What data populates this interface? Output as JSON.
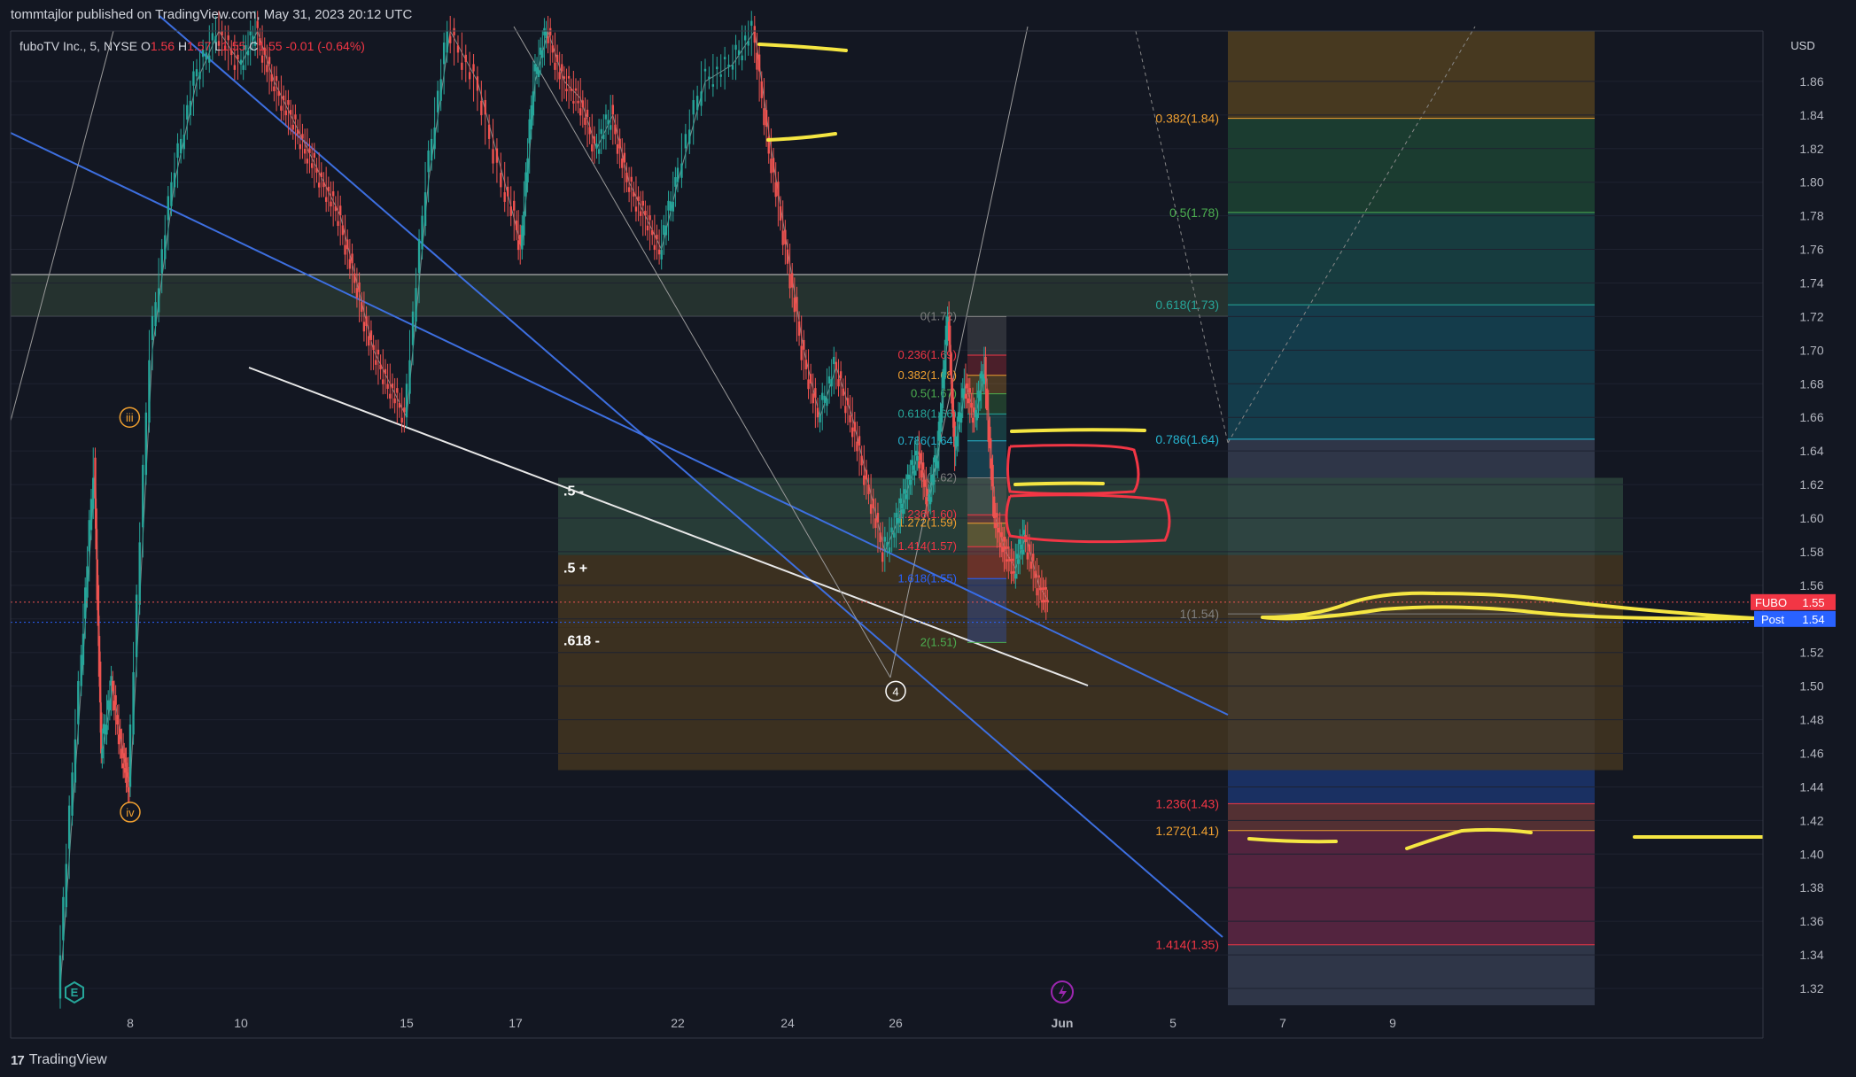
{
  "header": {
    "published": "tommtajlor published on TradingView.com, May 31, 2023 20:12 UTC"
  },
  "legend": {
    "symbol": "fuboTV Inc., 5, NYSE",
    "o_label": "O",
    "o_value": "1.56",
    "h_label": "H",
    "h_value": "1.57",
    "l_label": "L",
    "l_value": "1.55",
    "c_label": "C",
    "c_value": "1.55",
    "change": "-0.01 (-0.64%)"
  },
  "footer": {
    "brand": "TradingView"
  },
  "colors": {
    "background": "#131722",
    "up": "#26a69a",
    "down": "#ef5350",
    "yellow_marker": "#f5e642",
    "red_marker": "#f23645",
    "trend_blue": "#3d6fe0"
  },
  "chart_data": {
    "type": "candlestick",
    "title": "",
    "symbol": "FUBO",
    "currency": "USD",
    "ylim": [
      1.31,
      1.89
    ],
    "y_ticks": [
      "1.86",
      "1.84",
      "1.82",
      "1.80",
      "1.78",
      "1.76",
      "1.74",
      "1.72",
      "1.70",
      "1.68",
      "1.66",
      "1.64",
      "1.62",
      "1.60",
      "1.58",
      "1.56",
      "1.54",
      "1.52",
      "1.50",
      "1.48",
      "1.46",
      "1.44",
      "1.42",
      "1.40",
      "1.38",
      "1.36",
      "1.34",
      "1.32"
    ],
    "x_ticks": [
      {
        "label": "8",
        "day": 8
      },
      {
        "label": "10",
        "day": 10
      },
      {
        "label": "15",
        "day": 15
      },
      {
        "label": "17",
        "day": 17
      },
      {
        "label": "22",
        "day": 22
      },
      {
        "label": "24",
        "day": 24
      },
      {
        "label": "26",
        "day": 26
      },
      {
        "label": "Jun",
        "day": 31
      },
      {
        "label": "5",
        "day": 35
      },
      {
        "label": "7",
        "day": 37
      },
      {
        "label": "9",
        "day": 39
      }
    ],
    "price_path": [
      [
        6.0,
        1.32
      ],
      [
        6.6,
        1.5
      ],
      [
        7.0,
        1.63
      ],
      [
        7.2,
        1.46
      ],
      [
        7.5,
        1.5
      ],
      [
        7.8,
        1.46
      ],
      [
        8.0,
        1.44
      ],
      [
        8.4,
        1.7
      ],
      [
        8.8,
        1.8
      ],
      [
        9.2,
        1.86
      ],
      [
        9.6,
        1.89
      ],
      [
        10.0,
        1.87
      ],
      [
        10.5,
        1.89
      ],
      [
        11.0,
        1.86
      ],
      [
        11.5,
        1.84
      ],
      [
        12.0,
        1.82
      ],
      [
        12.5,
        1.8
      ],
      [
        13.0,
        1.78
      ],
      [
        13.5,
        1.74
      ],
      [
        14.0,
        1.7
      ],
      [
        14.5,
        1.68
      ],
      [
        15.0,
        1.66
      ],
      [
        15.4,
        1.8
      ],
      [
        15.8,
        1.89
      ],
      [
        16.3,
        1.86
      ],
      [
        16.8,
        1.8
      ],
      [
        17.2,
        1.76
      ],
      [
        17.6,
        1.86
      ],
      [
        18.0,
        1.89
      ],
      [
        18.5,
        1.86
      ],
      [
        19.0,
        1.85
      ],
      [
        19.5,
        1.82
      ],
      [
        20.0,
        1.84
      ],
      [
        20.5,
        1.8
      ],
      [
        21.0,
        1.78
      ],
      [
        21.5,
        1.76
      ],
      [
        22.0,
        1.8
      ],
      [
        22.5,
        1.86
      ],
      [
        23.0,
        1.87
      ],
      [
        23.4,
        1.89
      ],
      [
        23.7,
        1.82
      ],
      [
        24.0,
        1.76
      ],
      [
        24.3,
        1.7
      ],
      [
        24.6,
        1.66
      ],
      [
        24.9,
        1.69
      ],
      [
        25.2,
        1.66
      ],
      [
        25.5,
        1.62
      ],
      [
        25.8,
        1.58
      ],
      [
        26.1,
        1.6
      ],
      [
        26.4,
        1.62
      ],
      [
        26.7,
        1.64
      ],
      [
        27.0,
        1.61
      ],
      [
        27.3,
        1.64
      ],
      [
        27.6,
        1.72
      ],
      [
        27.8,
        1.64
      ],
      [
        28.1,
        1.68
      ],
      [
        28.4,
        1.66
      ],
      [
        28.7,
        1.69
      ],
      [
        29.0,
        1.6
      ],
      [
        29.3,
        1.58
      ],
      [
        29.6,
        1.57
      ],
      [
        29.9,
        1.59
      ],
      [
        30.3,
        1.56
      ],
      [
        30.6,
        1.55
      ]
    ],
    "last_price": {
      "symbol": "FUBO",
      "value": "1.55"
    },
    "post_price": {
      "label": "Post",
      "value": "1.54"
    },
    "horizontal_band": {
      "from": 1.72,
      "to": 1.745
    },
    "zones": [
      {
        "name": ".5 -",
        "from": 1.578,
        "to": 1.624,
        "color": "#2f4a3f"
      },
      {
        "name": ".5 +",
        "from": 1.535,
        "to": 1.578,
        "color": "#4a3a20"
      },
      {
        "name": ".618 -",
        "from": 1.45,
        "to": 1.535,
        "color": "#4a3a20"
      }
    ],
    "fib_right": [
      {
        "label": "0.382(1.84)",
        "value": 1.838,
        "color": "#f0a030"
      },
      {
        "label": "0.5(1.78)",
        "value": 1.782,
        "color": "#4caf50"
      },
      {
        "label": "0.618(1.73)",
        "value": 1.727,
        "color": "#26a69a"
      },
      {
        "label": "0.786(1.64)",
        "value": 1.647,
        "color": "#26b5d0"
      },
      {
        "label": "1(1.54)",
        "value": 1.543,
        "color": "#808080"
      },
      {
        "label": "1.236(1.43)",
        "value": 1.43,
        "color": "#f23645"
      },
      {
        "label": "1.272(1.41)",
        "value": 1.414,
        "color": "#f0a030"
      },
      {
        "label": "1.414(1.35)",
        "value": 1.346,
        "color": "#f23645"
      }
    ],
    "fib_right_bands": [
      {
        "from": 1.838,
        "to": 1.89,
        "color": "#5a4520"
      },
      {
        "from": 1.782,
        "to": 1.838,
        "color": "#1f4a35"
      },
      {
        "from": 1.727,
        "to": 1.782,
        "color": "#1a4a4a"
      },
      {
        "from": 1.647,
        "to": 1.727,
        "color": "#164a5a"
      },
      {
        "from": 1.543,
        "to": 1.647,
        "color": "#3a4256"
      },
      {
        "from": 1.45,
        "to": 1.543,
        "color": "#3a4256"
      },
      {
        "from": 1.43,
        "to": 1.45,
        "color": "#1e3a78"
      },
      {
        "from": 1.414,
        "to": 1.43,
        "color": "#6a3a3a"
      },
      {
        "from": 1.346,
        "to": 1.414,
        "color": "#6a2a4a"
      },
      {
        "from": 1.31,
        "to": 1.346,
        "color": "#3a4256"
      }
    ],
    "fib_mid": [
      {
        "label": "0(1.72)",
        "value": 1.72,
        "color": "#808080"
      },
      {
        "label": "0.236(1.69)",
        "value": 1.697,
        "color": "#f23645"
      },
      {
        "label": "0.382(1.68)",
        "value": 1.685,
        "color": "#f0a030"
      },
      {
        "label": "0.5(1.67)",
        "value": 1.674,
        "color": "#4caf50"
      },
      {
        "label": "0.618(1.66)",
        "value": 1.662,
        "color": "#26a69a"
      },
      {
        "label": "0.786(1.64)",
        "value": 1.646,
        "color": "#26b5d0"
      },
      {
        "label": "1(1.62)",
        "value": 1.624,
        "color": "#808080"
      },
      {
        "label": "1.236(1.60)",
        "value": 1.602,
        "color": "#f23645"
      },
      {
        "label": "1.272(1.59)",
        "value": 1.597,
        "color": "#f0a030"
      },
      {
        "label": "1.414(1.57)",
        "value": 1.583,
        "color": "#f23645"
      },
      {
        "label": "1.618(1.55)",
        "value": 1.564,
        "color": "#2962ff"
      },
      {
        "label": "2(1.51)",
        "value": 1.526,
        "color": "#4caf50"
      }
    ],
    "wave_labels": [
      {
        "label": "iii",
        "day": 7.3,
        "value": 1.66
      },
      {
        "label": "iv",
        "day": 8.0,
        "value": 1.425
      },
      {
        "label": "4",
        "day": 26.0,
        "value": 1.497
      }
    ]
  }
}
